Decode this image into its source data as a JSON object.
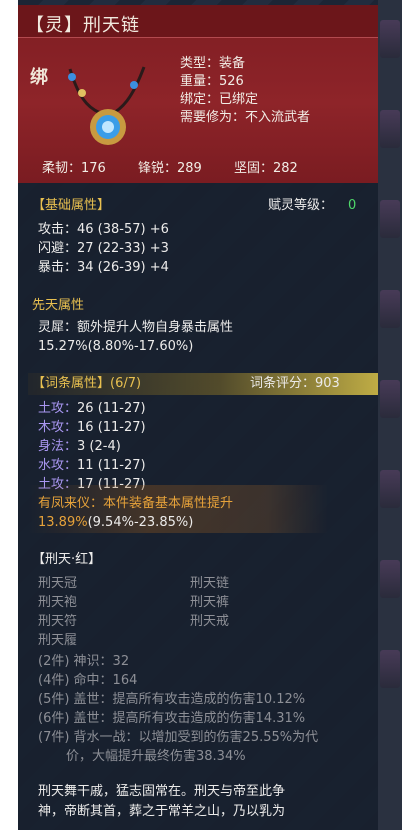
{
  "item": {
    "title": "【灵】刑天链",
    "bind_mark": "绑",
    "info": [
      "类型：装备",
      "重量：526",
      "绑定：已绑定",
      "需要修为：不入流武者"
    ],
    "stats": [
      "柔韧：176",
      "锋锐：289",
      "坚固：282"
    ]
  },
  "basic": {
    "header": "【基础属性】",
    "spirit_level_label": "赋灵等级：",
    "spirit_level_value": "0",
    "rows": [
      "攻击：46 (38-57) +6",
      "闪避：27 (22-33) +3",
      "暴击：34 (26-39) +4"
    ]
  },
  "innate": {
    "header": "先天属性",
    "desc": "灵犀：额外提升人物自身暴击属性",
    "value": "15.27%",
    "range": "(8.80%-17.60%)"
  },
  "affix": {
    "header": "【词条属性】(6/7)",
    "score": "词条评分：903",
    "rows": [
      {
        "name": "土攻：",
        "value": "26 (11-27)"
      },
      {
        "name": "木攻：",
        "value": "16 (11-27)"
      },
      {
        "name": "身法：",
        "value": "3 (2-4)"
      },
      {
        "name": "水攻：",
        "value": "11 (11-27)"
      },
      {
        "name": "土攻：",
        "value": "17 (11-27)"
      }
    ],
    "special_name": "有凤来仪：本件装备基本属性提升",
    "special_value": "13.89%",
    "special_range": "(9.54%-23.85%)"
  },
  "set": {
    "header": "【刑天·红】",
    "pieces": [
      "刑天冠",
      "刑天链",
      "刑天袍",
      "刑天裤",
      "刑天符",
      "刑天戒",
      "刑天履"
    ],
    "bonuses": [
      "(2件) 神识：32",
      "(4件) 命中：164",
      "(5件) 盖世：提高所有攻击造成的伤害10.12%",
      "(6件) 盖世：提高所有攻击造成的伤害14.31%",
      "(7件) 背水一战：以增加受到的伤害25.55%为代",
      "价，大幅提升最终伤害38.34%"
    ]
  },
  "lore": [
    "刑天舞干戚，猛志固常在。刑天与帝至此争",
    "神，帝断其首，葬之于常羊之山，乃以乳为"
  ],
  "colors": {
    "header": "#8e2429",
    "gold": "#e8c050",
    "purple": "#a896f0",
    "green": "#4fd86a",
    "orange": "#e6a23a"
  }
}
